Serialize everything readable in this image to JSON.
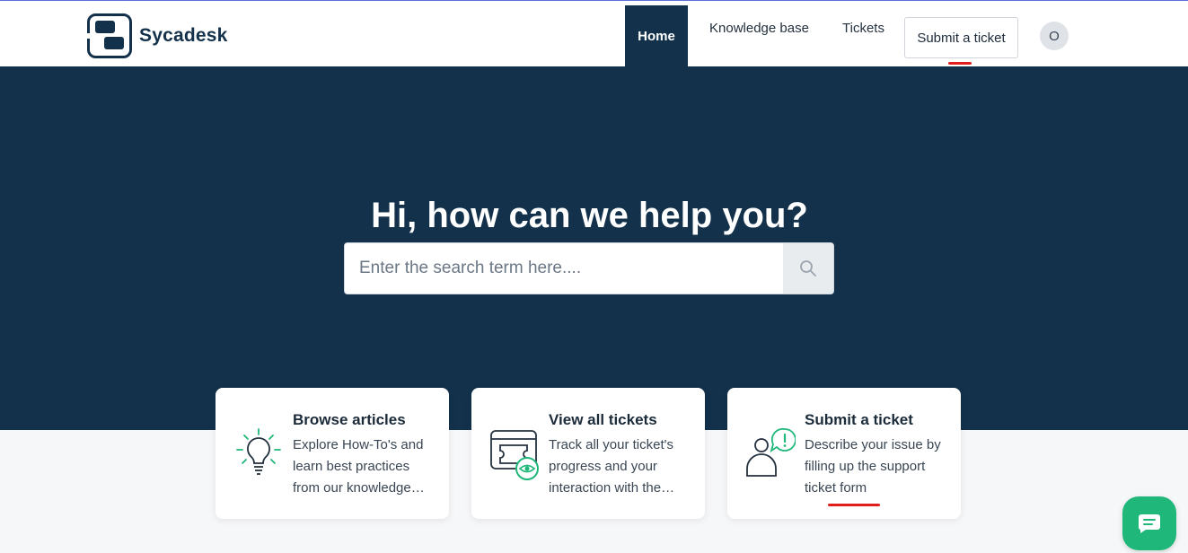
{
  "brand": {
    "name": "Sycadesk",
    "logo": "sycadesk-logo"
  },
  "nav": {
    "home": "Home",
    "knowledge_base": "Knowledge base",
    "tickets": "Tickets",
    "submit": "Submit a ticket",
    "avatar_initial": "O"
  },
  "hero": {
    "title": "Hi, how can we help you?",
    "search_placeholder": "Enter the search term here....",
    "search_icon": "search-icon"
  },
  "cards": [
    {
      "title": "Browse articles",
      "description": "Explore How-To's and learn best practices from our knowledge base",
      "icon": "lightbulb-icon"
    },
    {
      "title": "View all tickets",
      "description": "Track all your ticket's progress and your interaction with the support team",
      "icon": "ticket-eye-icon"
    },
    {
      "title": "Submit a ticket",
      "description": "Describe your issue by filling up the support ticket form",
      "icon": "user-alert-icon"
    }
  ],
  "colors": {
    "primary": "#13314b",
    "accent": "#20b77a",
    "annotation": "#e01e1e"
  },
  "chat": {
    "icon": "chat-icon"
  }
}
